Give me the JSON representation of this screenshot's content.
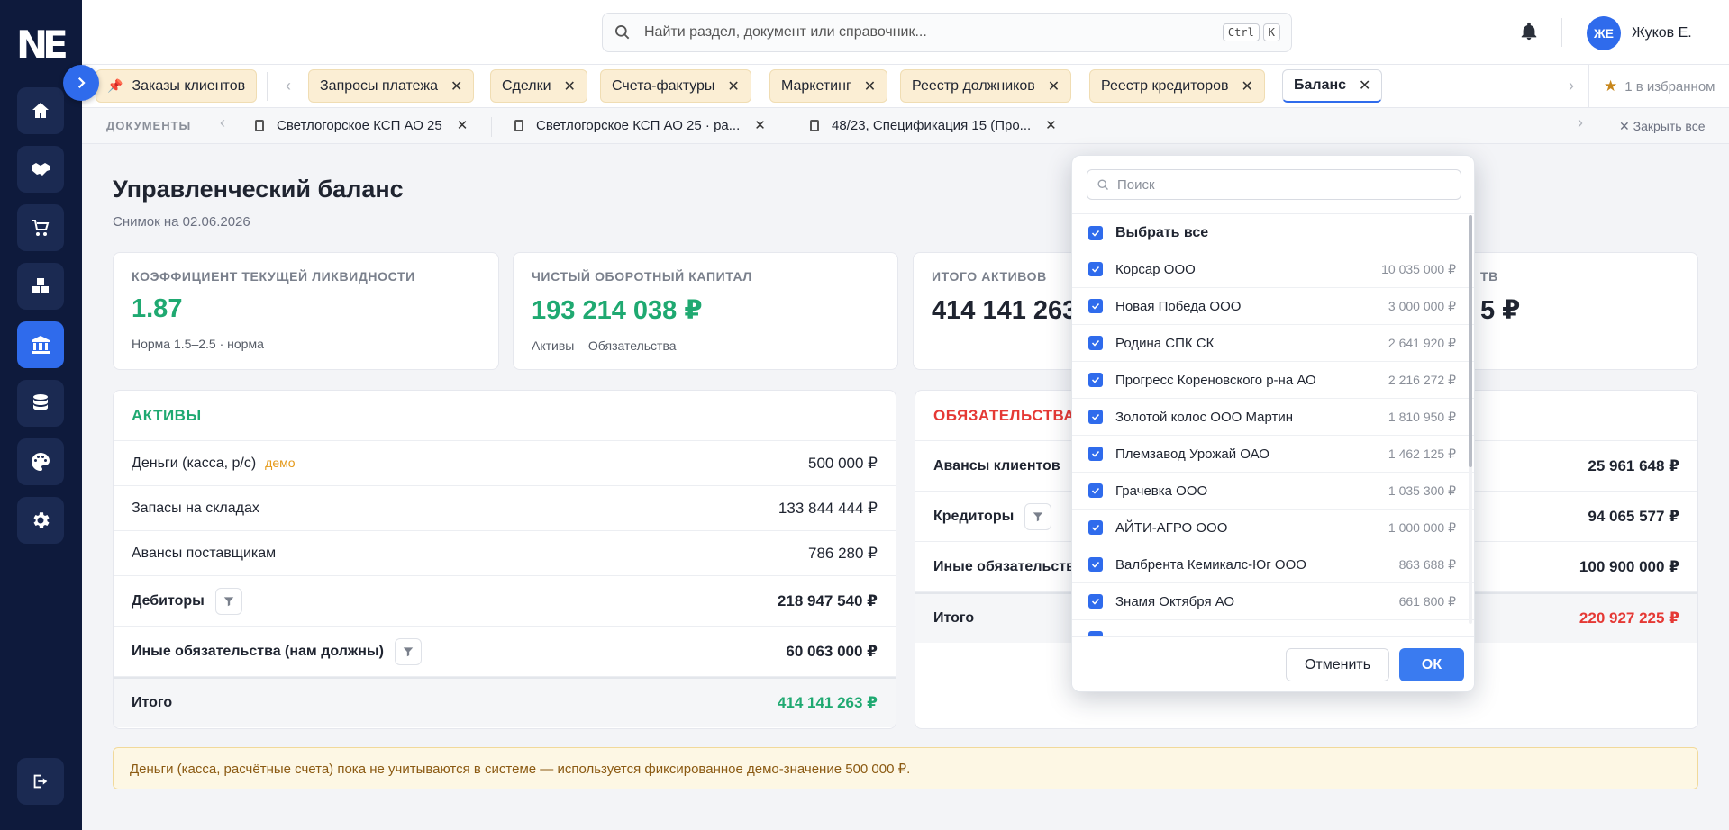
{
  "app": {
    "logo": "NE"
  },
  "header": {
    "search_placeholder": "Найти раздел, документ или справочник...",
    "kbd1": "Ctrl",
    "kbd2": "K",
    "user_initials": "ЖЕ",
    "user_name": "Жуков Е."
  },
  "tabs": {
    "pinned": "Заказы клиентов",
    "items": [
      {
        "label": "Запросы платежа"
      },
      {
        "label": "Сделки"
      },
      {
        "label": "Счета-фактуры"
      },
      {
        "label": "Маркетинг"
      },
      {
        "label": "Реестр должников"
      },
      {
        "label": "Реестр кредиторов"
      },
      {
        "label": "Баланс"
      }
    ],
    "close": "✕",
    "favorites": "1 в избранном"
  },
  "docs": {
    "label": "ДОКУМЕНТЫ",
    "items": [
      {
        "label": "Светлогорское КСП АО 25"
      },
      {
        "label": "Светлогорское КСП АО 25 · ра..."
      },
      {
        "label": "48/23, Спецификация 15 (Про..."
      }
    ],
    "close_all": "Закрыть все"
  },
  "page": {
    "title": "Управленческий баланс",
    "subtitle": "Снимок на 02.06.2026"
  },
  "kpis": [
    {
      "label": "КОЭФФИЦИЕНТ ТЕКУЩЕЙ ЛИКВИДНОСТИ",
      "value": "1.87",
      "hint": "Норма 1.5–2.5 · норма"
    },
    {
      "label": "ЧИСТЫЙ ОБОРОТНЫЙ КАПИТАЛ",
      "value": "193 214 038 ₽",
      "hint": "Активы – Обязательства"
    },
    {
      "label": "ИТОГО АКТИВОВ",
      "value": "414 141 263 ₽"
    },
    {
      "label_tail": "ТВ",
      "value_tail": "5 ₽"
    }
  ],
  "assets": {
    "title": "АКТИВЫ",
    "rows": [
      {
        "label": "Деньги (касса, р/с)",
        "badge": "демо",
        "amount": "500 000 ₽"
      },
      {
        "label": "Запасы на складах",
        "amount": "133 844 444 ₽"
      },
      {
        "label": "Авансы поставщикам",
        "amount": "786 280 ₽"
      },
      {
        "label": "Дебиторы",
        "amount": "218 947 540 ₽"
      },
      {
        "label": "Иные обязательства (нам должны)",
        "amount": "60 063 000 ₽"
      }
    ],
    "total_label": "Итого",
    "total": "414 141 263 ₽"
  },
  "liabilities": {
    "title": "ОБЯЗАТЕЛЬСТВА",
    "rows": [
      {
        "label": "Авансы клиентов",
        "amount": "25 961 648 ₽"
      },
      {
        "label": "Кредиторы",
        "amount": "94 065 577 ₽"
      },
      {
        "label": "Иные обязательства",
        "amount": "100 900 000 ₽"
      }
    ],
    "total_label": "Итого",
    "total": "220 927 225 ₽"
  },
  "notice": "Деньги (касса, расчётные счета) пока не учитываются в системе — используется фиксированное демо-значение 500 000 ₽.",
  "dropdown": {
    "search_placeholder": "Поиск",
    "select_all": "Выбрать все",
    "items": [
      {
        "name": "Корсар ООО",
        "sum": "10 035 000 ₽"
      },
      {
        "name": "Новая Победа ООО",
        "sum": "3 000 000 ₽"
      },
      {
        "name": "Родина СПК СК",
        "sum": "2 641 920 ₽"
      },
      {
        "name": "Прогресс Кореновского р-на АО",
        "sum": "2 216 272 ₽"
      },
      {
        "name": "Золотой колос ООО Мартин",
        "sum": "1 810 950 ₽"
      },
      {
        "name": "Племзавод Урожай ОАО",
        "sum": "1 462 125 ₽"
      },
      {
        "name": "Грачевка ООО",
        "sum": "1 035 300 ₽"
      },
      {
        "name": "АЙТИ-АГРО ООО",
        "sum": "1 000 000 ₽"
      },
      {
        "name": "Валбрента Кемикалс-Юг ООО",
        "sum": "863 688 ₽"
      },
      {
        "name": "Знамя Октября АО",
        "sum": "661 800 ₽"
      }
    ],
    "cancel": "Отменить",
    "ok": "ОК"
  }
}
